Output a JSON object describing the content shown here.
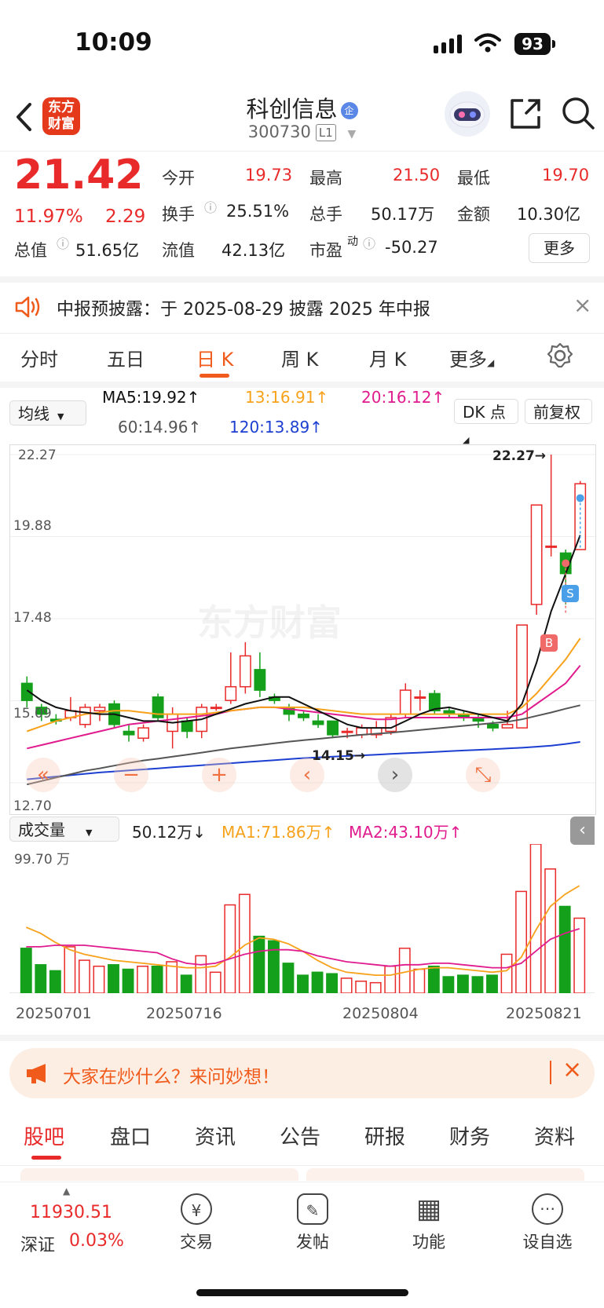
{
  "status": {
    "time": "10:09",
    "battery": "93"
  },
  "header": {
    "logo_line1": "东方",
    "logo_line2": "财富",
    "name": "科创信息",
    "badge": "企",
    "code": "300730",
    "level": "L1"
  },
  "quote": {
    "price": "21.42",
    "change_pct": "11.97%",
    "change": "2.29",
    "open_label": "今开",
    "open": "19.73",
    "high_label": "最高",
    "high": "21.50",
    "low_label": "最低",
    "low": "19.70",
    "turnover_label": "换手",
    "turnover": "25.51%",
    "volume_label": "总手",
    "volume": "50.17万",
    "amount_label": "金额",
    "amount": "10.30亿",
    "mcap_label": "总值",
    "mcap": "51.65亿",
    "float_label": "流值",
    "float": "42.13亿",
    "pe_label": "市盈",
    "pe_sup": "动",
    "pe": "-50.27",
    "more": "更多"
  },
  "notice": {
    "text": "中报预披露：于 2025-08-29 披露 2025 年中报"
  },
  "tabs": [
    {
      "label": "分时"
    },
    {
      "label": "五日"
    },
    {
      "label": "日 K"
    },
    {
      "label": "周 K"
    },
    {
      "label": "月 K"
    },
    {
      "label": "更多"
    }
  ],
  "ma": {
    "select": "均线",
    "ma5": "MA5:19.92",
    "ma13": "13:16.91",
    "ma20": "20:16.12",
    "ma60": "60:14.96",
    "ma120": "120:13.89",
    "dk": "DK 点",
    "fq": "前复权"
  },
  "kline": {
    "y_labels": [
      "22.27",
      "19.88",
      "17.48",
      "15.09",
      "12.70"
    ],
    "max_label": "22.27→",
    "min_label": "14.15→",
    "watermark": "东方财富",
    "b_marker": "B",
    "s_marker": "S"
  },
  "volume": {
    "select": "成交量",
    "vol": "50.12万",
    "ma1": "MA1:71.86万",
    "ma2": "MA2:43.10万",
    "y_label": "99.70 万",
    "dates": [
      "20250701",
      "20250716",
      "20250804",
      "20250821"
    ]
  },
  "chart_data": {
    "type": "candlestick",
    "ylim": [
      12.7,
      22.27
    ],
    "candles": [
      {
        "o": 15.6,
        "c": 15.1,
        "h": 15.8,
        "l": 14.9
      },
      {
        "o": 14.9,
        "c": 14.7,
        "h": 15.0,
        "l": 14.5
      },
      {
        "o": 14.55,
        "c": 14.5,
        "h": 14.7,
        "l": 14.4
      },
      {
        "o": 14.6,
        "c": 14.8,
        "h": 15.2,
        "l": 14.5
      },
      {
        "o": 14.4,
        "c": 14.9,
        "h": 15.0,
        "l": 14.3
      },
      {
        "o": 14.8,
        "c": 14.9,
        "h": 15.0,
        "l": 14.5
      },
      {
        "o": 15.0,
        "c": 14.4,
        "h": 15.1,
        "l": 14.3
      },
      {
        "o": 14.2,
        "c": 14.1,
        "h": 14.4,
        "l": 13.9
      },
      {
        "o": 14.0,
        "c": 14.3,
        "h": 14.4,
        "l": 13.9
      },
      {
        "o": 15.2,
        "c": 14.6,
        "h": 15.3,
        "l": 14.5
      },
      {
        "o": 14.2,
        "c": 14.7,
        "h": 14.9,
        "l": 13.7
      },
      {
        "o": 14.5,
        "c": 14.2,
        "h": 14.6,
        "l": 14.0
      },
      {
        "o": 14.2,
        "c": 14.9,
        "h": 15.0,
        "l": 14.0
      },
      {
        "o": 14.9,
        "c": 14.9,
        "h": 15.0,
        "l": 14.8
      },
      {
        "o": 15.1,
        "c": 15.5,
        "h": 16.5,
        "l": 15.0
      },
      {
        "o": 15.5,
        "c": 16.4,
        "h": 16.8,
        "l": 15.3
      },
      {
        "o": 16.0,
        "c": 15.4,
        "h": 16.5,
        "l": 15.2
      },
      {
        "o": 15.2,
        "c": 15.1,
        "h": 15.3,
        "l": 15.0
      },
      {
        "o": 14.9,
        "c": 14.7,
        "h": 15.0,
        "l": 14.5
      },
      {
        "o": 14.7,
        "c": 14.6,
        "h": 14.8,
        "l": 14.5
      },
      {
        "o": 14.5,
        "c": 14.4,
        "h": 14.7,
        "l": 14.3
      },
      {
        "o": 14.5,
        "c": 14.1,
        "h": 14.5,
        "l": 14.0
      },
      {
        "o": 14.2,
        "c": 14.2,
        "h": 14.3,
        "l": 14.0
      },
      {
        "o": 14.1,
        "c": 14.3,
        "h": 14.4,
        "l": 14.0
      },
      {
        "o": 14.1,
        "c": 14.3,
        "h": 14.5,
        "l": 14.0
      },
      {
        "o": 14.2,
        "c": 14.6,
        "h": 14.7,
        "l": 14.1
      },
      {
        "o": 14.7,
        "c": 15.4,
        "h": 15.6,
        "l": 14.6
      },
      {
        "o": 15.2,
        "c": 15.2,
        "h": 15.4,
        "l": 14.8
      },
      {
        "o": 15.3,
        "c": 14.8,
        "h": 15.4,
        "l": 14.7
      },
      {
        "o": 14.8,
        "c": 14.7,
        "h": 14.9,
        "l": 14.6
      },
      {
        "o": 14.7,
        "c": 14.6,
        "h": 14.8,
        "l": 14.5
      },
      {
        "o": 14.6,
        "c": 14.5,
        "h": 14.7,
        "l": 14.3
      },
      {
        "o": 14.4,
        "c": 14.3,
        "h": 14.5,
        "l": 14.2
      },
      {
        "o": 14.3,
        "c": 14.4,
        "h": 14.8,
        "l": 14.3
      },
      {
        "o": 14.3,
        "c": 17.3,
        "h": 17.3,
        "l": 14.3
      },
      {
        "o": 17.9,
        "c": 20.8,
        "h": 20.8,
        "l": 17.6
      },
      {
        "o": 19.6,
        "c": 19.6,
        "h": 22.27,
        "l": 19.3
      },
      {
        "o": 19.4,
        "c": 18.8,
        "h": 19.5,
        "l": 17.9
      },
      {
        "o": 19.5,
        "c": 21.42,
        "h": 21.5,
        "l": 19.5
      }
    ],
    "ma5": [
      15.4,
      15.1,
      14.9,
      14.8,
      14.75,
      14.7,
      14.7,
      14.6,
      14.5,
      14.5,
      14.45,
      14.5,
      14.55,
      14.7,
      14.85,
      15.0,
      15.1,
      15.2,
      15.2,
      15.0,
      14.8,
      14.6,
      14.4,
      14.3,
      14.3,
      14.3,
      14.5,
      14.7,
      14.85,
      14.9,
      14.8,
      14.7,
      14.6,
      14.5,
      15.0,
      16.2,
      17.7,
      18.8,
      19.92
    ],
    "ma13": [
      14.2,
      14.35,
      14.5,
      14.6,
      14.7,
      14.75,
      14.8,
      14.8,
      14.75,
      14.7,
      14.7,
      14.7,
      14.7,
      14.75,
      14.8,
      14.85,
      14.9,
      14.9,
      14.9,
      14.9,
      14.85,
      14.8,
      14.75,
      14.7,
      14.7,
      14.7,
      14.7,
      14.7,
      14.7,
      14.7,
      14.7,
      14.7,
      14.7,
      14.7,
      14.9,
      15.3,
      15.8,
      16.3,
      16.91
    ],
    "ma20": [
      13.7,
      13.8,
      13.9,
      14.0,
      14.1,
      14.2,
      14.3,
      14.4,
      14.45,
      14.5,
      14.55,
      14.6,
      14.65,
      14.7,
      14.8,
      14.85,
      14.9,
      14.9,
      14.85,
      14.8,
      14.75,
      14.7,
      14.65,
      14.6,
      14.55,
      14.55,
      14.6,
      14.6,
      14.6,
      14.6,
      14.6,
      14.6,
      14.6,
      14.6,
      14.7,
      15.0,
      15.3,
      15.6,
      16.12
    ],
    "ma60": [
      12.65,
      12.75,
      12.85,
      12.95,
      13.05,
      13.12,
      13.2,
      13.28,
      13.35,
      13.4,
      13.46,
      13.52,
      13.58,
      13.64,
      13.7,
      13.75,
      13.8,
      13.85,
      13.9,
      13.94,
      13.98,
      14.02,
      14.06,
      14.1,
      14.13,
      14.16,
      14.2,
      14.24,
      14.28,
      14.32,
      14.36,
      14.4,
      14.44,
      14.48,
      14.55,
      14.65,
      14.75,
      14.86,
      14.96
    ],
    "ma120": [
      12.8,
      12.84,
      12.88,
      12.92,
      12.96,
      13.0,
      13.03,
      13.06,
      13.09,
      13.12,
      13.15,
      13.18,
      13.21,
      13.24,
      13.27,
      13.3,
      13.33,
      13.36,
      13.39,
      13.42,
      13.44,
      13.46,
      13.48,
      13.5,
      13.52,
      13.54,
      13.56,
      13.58,
      13.6,
      13.62,
      13.64,
      13.66,
      13.68,
      13.7,
      13.72,
      13.75,
      13.78,
      13.83,
      13.89
    ],
    "volume_ylim": [
      0,
      99.7
    ],
    "volumes": [
      30,
      19,
      15,
      31,
      22,
      18,
      19,
      16,
      18,
      18,
      21,
      12,
      25,
      14,
      59,
      66,
      38,
      35,
      20,
      12,
      14,
      13,
      10,
      8,
      7,
      18,
      30,
      16,
      18,
      11,
      12,
      11,
      12,
      26,
      68,
      99.7,
      83,
      58,
      50.12
    ],
    "vol_ma1": [
      44,
      40,
      34,
      29,
      26,
      24,
      22,
      21,
      20,
      19,
      18,
      17,
      17,
      18,
      24,
      32,
      37,
      36,
      33,
      28,
      22,
      17,
      14,
      13,
      12,
      12,
      14,
      16,
      17,
      17,
      16,
      15,
      14,
      15,
      24,
      42,
      58,
      66,
      71.86
    ],
    "vol_ma2": [
      31,
      31,
      32,
      32,
      32,
      31,
      30,
      29,
      28,
      27,
      23,
      20,
      19,
      20,
      23,
      26,
      28,
      29,
      29,
      28,
      25,
      23,
      21,
      20,
      19,
      18,
      19,
      19,
      20,
      20,
      19,
      18,
      17,
      17,
      20,
      28,
      36,
      40,
      43.1
    ]
  },
  "promo": {
    "text": "大家在炒什么？来问妙想！"
  },
  "bottom_tabs": [
    {
      "label": "股吧"
    },
    {
      "label": "盘口"
    },
    {
      "label": "资讯"
    },
    {
      "label": "公告"
    },
    {
      "label": "研报"
    },
    {
      "label": "财务"
    },
    {
      "label": "资料"
    }
  ],
  "index": {
    "value": "11930.51",
    "name": "深证",
    "pct": "0.03%"
  },
  "nav": [
    {
      "label": "交易",
      "icon": "¥"
    },
    {
      "label": "发帖",
      "icon": "✎"
    },
    {
      "label": "功能",
      "icon": "▦"
    },
    {
      "label": "设自选",
      "icon": "⋯"
    }
  ],
  "colors": {
    "up": "#e92a2a",
    "down": "#14a01a",
    "ma5": "#111111",
    "ma13": "#f7a21b",
    "ma20": "#e01b8e",
    "ma60": "#555555",
    "ma120": "#1d3fd1",
    "accent": "#f05a1a"
  }
}
